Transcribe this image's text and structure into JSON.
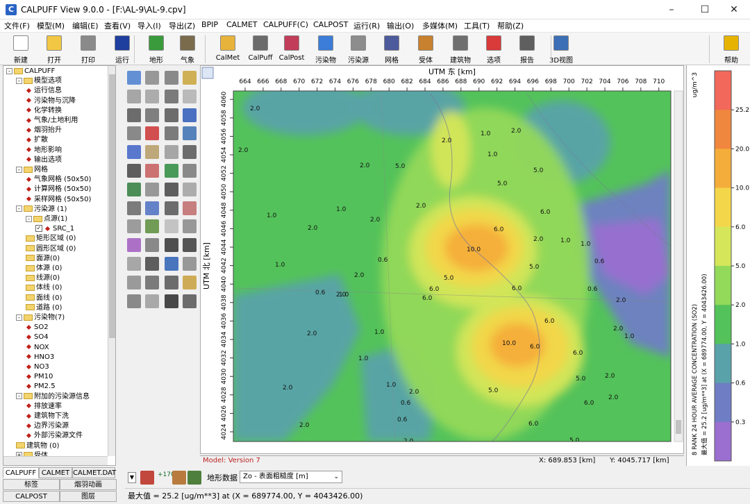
{
  "window": {
    "title": "CALPUFF View 9.0.0 - [F:\\AL-9\\AL-9.cpv]",
    "controls": [
      "–",
      "☐",
      "✕"
    ]
  },
  "menu": [
    "文件(F)",
    "模型(M)",
    "编辑(E)",
    "查看(V)",
    "导入(I)",
    "导出(Z)",
    "BPIP",
    "CALMET",
    "CALPUFF(C)",
    "CALPOST",
    "运行(R)",
    "输出(O)",
    "多媒体(M)",
    "工具(T)",
    "帮助(Z)"
  ],
  "toolbar": [
    {
      "label": "新建",
      "color": "#ffffff",
      "icon": "new-file-icon"
    },
    {
      "label": "打开",
      "color": "#f2c744",
      "icon": "open-folder-icon"
    },
    {
      "label": "打印",
      "color": "#8a8a8a",
      "icon": "printer-icon"
    },
    {
      "label": "运行",
      "color": "#1f3f9e",
      "icon": "run-triangle-icon"
    },
    {
      "label": "地形",
      "color": "#3a9b3c",
      "icon": "terrain-icon"
    },
    {
      "label": "气象",
      "color": "#7b6b4d",
      "icon": "meteorology-icon"
    },
    {
      "label": "CalMet",
      "color": "#e8b33a",
      "icon": "calmet-icon"
    },
    {
      "label": "CalPuff",
      "color": "#6b6b6b",
      "icon": "calpuff-icon"
    },
    {
      "label": "CalPost",
      "color": "#c23d5a",
      "icon": "calpost-icon"
    },
    {
      "label": "污染物",
      "color": "#3b7dd8",
      "icon": "pollutant-icon"
    },
    {
      "label": "污染源",
      "color": "#8d8d8d",
      "icon": "source-icon"
    },
    {
      "label": "网格",
      "color": "#4d5a9c",
      "icon": "grid-icon"
    },
    {
      "label": "受体",
      "color": "#c8812f",
      "icon": "receptor-icon"
    },
    {
      "label": "建筑物",
      "color": "#6f6f6f",
      "icon": "building-icon"
    },
    {
      "label": "选项",
      "color": "#d93a3a",
      "icon": "options-icon"
    },
    {
      "label": "报告",
      "color": "#5f5f5f",
      "icon": "report-icon"
    },
    {
      "label": "3D视图",
      "color": "#3d6fb6",
      "icon": "3d-view-icon"
    },
    {
      "label": "帮助",
      "color": "#e6b400",
      "icon": "help-icon"
    }
  ],
  "tree": [
    {
      "label": "CALPUFF",
      "level": 0,
      "type": "folder",
      "exp": "-"
    },
    {
      "label": "模型选项",
      "level": 1,
      "type": "folder",
      "exp": "-"
    },
    {
      "label": "运行信息",
      "level": 2,
      "type": "item"
    },
    {
      "label": "污染物与沉降",
      "level": 2,
      "type": "item"
    },
    {
      "label": "化学转换",
      "level": 2,
      "type": "item"
    },
    {
      "label": "气象/土地利用",
      "level": 2,
      "type": "item"
    },
    {
      "label": "烟羽抬升",
      "level": 2,
      "type": "item"
    },
    {
      "label": "扩散",
      "level": 2,
      "type": "item"
    },
    {
      "label": "地形影响",
      "level": 2,
      "type": "item"
    },
    {
      "label": "输出选项",
      "level": 2,
      "type": "item"
    },
    {
      "label": "网格",
      "level": 1,
      "type": "folder",
      "exp": "-"
    },
    {
      "label": "气象网格 (50x50)",
      "level": 2,
      "type": "item"
    },
    {
      "label": "计算网格 (50x50)",
      "level": 2,
      "type": "item"
    },
    {
      "label": "采样网格 (50x50)",
      "level": 2,
      "type": "item"
    },
    {
      "label": "污染源 (1)",
      "level": 1,
      "type": "folder",
      "exp": "-"
    },
    {
      "label": "点源(1)",
      "level": 2,
      "type": "folder",
      "exp": "-"
    },
    {
      "label": "SRC_1",
      "level": 3,
      "type": "check"
    },
    {
      "label": "矩形区域 (0)",
      "level": 2,
      "type": "folder"
    },
    {
      "label": "圆形区域 (0)",
      "level": 2,
      "type": "folder"
    },
    {
      "label": "面源(0)",
      "level": 2,
      "type": "folder"
    },
    {
      "label": "体源 (0)",
      "level": 2,
      "type": "folder"
    },
    {
      "label": "线源(0)",
      "level": 2,
      "type": "folder"
    },
    {
      "label": "体线 (0)",
      "level": 2,
      "type": "folder"
    },
    {
      "label": "面线 (0)",
      "level": 2,
      "type": "folder"
    },
    {
      "label": "道路 (0)",
      "level": 2,
      "type": "folder"
    },
    {
      "label": "污染物(7)",
      "level": 1,
      "type": "folder",
      "exp": "-"
    },
    {
      "label": "SO2",
      "level": 2,
      "type": "item"
    },
    {
      "label": "SO4",
      "level": 2,
      "type": "item"
    },
    {
      "label": "NOX",
      "level": 2,
      "type": "item"
    },
    {
      "label": "HNO3",
      "level": 2,
      "type": "item"
    },
    {
      "label": "NO3",
      "level": 2,
      "type": "item"
    },
    {
      "label": "PM10",
      "level": 2,
      "type": "item"
    },
    {
      "label": "PM2.5",
      "level": 2,
      "type": "item"
    },
    {
      "label": "附加的污染源信息",
      "level": 1,
      "type": "folder",
      "exp": "-"
    },
    {
      "label": "排放速率",
      "level": 2,
      "type": "item"
    },
    {
      "label": "建筑物下洗",
      "level": 2,
      "type": "item"
    },
    {
      "label": "边界污染源",
      "level": 2,
      "type": "item"
    },
    {
      "label": "外部污染源文件",
      "level": 2,
      "type": "item"
    },
    {
      "label": "建筑物 (0)",
      "level": 1,
      "type": "folder"
    },
    {
      "label": "受体",
      "level": 1,
      "type": "folder",
      "exp": "+"
    }
  ],
  "tabs_row1": [
    "CALPUFF",
    "CALMET",
    "CALMET.DAT"
  ],
  "tabs_row2": [
    "标签",
    "烟羽动画"
  ],
  "tabs_row3": [
    "CALPOST",
    "图层"
  ],
  "map": {
    "xlabel": "UTM 东 [km]",
    "ylabel": "UTM 北 [km]",
    "xticks": [
      "664",
      "666",
      "668",
      "670",
      "672",
      "674",
      "676",
      "678",
      "680",
      "682",
      "684",
      "686",
      "688",
      "690",
      "692",
      "694",
      "696",
      "698",
      "700",
      "702",
      "704",
      "706",
      "708",
      "710"
    ],
    "yticks": [
      "4024",
      "4026",
      "4028",
      "4030",
      "4032",
      "4034",
      "4036",
      "4038",
      "4040",
      "4042",
      "4044",
      "4046",
      "4048",
      "4050",
      "4052",
      "4054",
      "4056",
      "4058",
      "4060"
    ],
    "contours": [
      {
        "v": "2.0",
        "x": 7,
        "y": 88
      },
      {
        "v": "2.0",
        "x": 24,
        "y": 28
      },
      {
        "v": "1.0",
        "x": 48,
        "y": 182
      },
      {
        "v": "2.0",
        "x": 107,
        "y": 200
      },
      {
        "v": "2.0",
        "x": 182,
        "y": 110
      },
      {
        "v": "1.0",
        "x": 148,
        "y": 173
      },
      {
        "v": "1.0",
        "x": 60,
        "y": 253
      },
      {
        "v": "0.6",
        "x": 118,
        "y": 293
      },
      {
        "v": "2.0",
        "x": 106,
        "y": 352
      },
      {
        "v": "2.0",
        "x": 71,
        "y": 430
      },
      {
        "v": "2.0",
        "x": 95,
        "y": 484
      },
      {
        "v": "1.0",
        "x": 180,
        "y": 388
      },
      {
        "v": "1.0",
        "x": 220,
        "y": 426
      },
      {
        "v": "2.0",
        "x": 148,
        "y": 296
      },
      {
        "v": "6.0",
        "x": 272,
        "y": 301
      },
      {
        "v": "2.0",
        "x": 197,
        "y": 188
      },
      {
        "v": "2.0",
        "x": 263,
        "y": 168
      },
      {
        "v": "0.6",
        "x": 208,
        "y": 246
      },
      {
        "v": "2.0",
        "x": 174,
        "y": 268
      },
      {
        "v": "1.0",
        "x": 203,
        "y": 350
      },
      {
        "v": "1.0",
        "x": 152,
        "y": 296
      },
      {
        "v": "0.6",
        "x": 241,
        "y": 452
      },
      {
        "v": "5.0",
        "x": 233,
        "y": 111
      },
      {
        "v": "2.0",
        "x": 300,
        "y": 74
      },
      {
        "v": "5.0",
        "x": 380,
        "y": 136
      },
      {
        "v": "6.0",
        "x": 375,
        "y": 202
      },
      {
        "v": "10.0",
        "x": 336,
        "y": 231
      },
      {
        "v": "5.0",
        "x": 303,
        "y": 272
      },
      {
        "v": "6.0",
        "x": 282,
        "y": 288
      },
      {
        "v": "6.0",
        "x": 401,
        "y": 287
      },
      {
        "v": "5.0",
        "x": 426,
        "y": 256
      },
      {
        "v": "2.0",
        "x": 432,
        "y": 216
      },
      {
        "v": "1.0",
        "x": 366,
        "y": 94
      },
      {
        "v": "2.0",
        "x": 400,
        "y": 60
      },
      {
        "v": "5.0",
        "x": 432,
        "y": 117
      },
      {
        "v": "6.0",
        "x": 442,
        "y": 177
      },
      {
        "v": "1.0",
        "x": 471,
        "y": 218
      },
      {
        "v": "0.6",
        "x": 520,
        "y": 248
      },
      {
        "v": "0.6",
        "x": 510,
        "y": 288
      },
      {
        "v": "1.0",
        "x": 500,
        "y": 223
      },
      {
        "v": "2.0",
        "x": 547,
        "y": 345
      },
      {
        "v": "1.0",
        "x": 563,
        "y": 356
      },
      {
        "v": "2.0",
        "x": 551,
        "y": 304
      },
      {
        "v": "6.0",
        "x": 448,
        "y": 334
      },
      {
        "v": "6.0",
        "x": 489,
        "y": 380
      },
      {
        "v": "10.0",
        "x": 387,
        "y": 366
      },
      {
        "v": "6.0",
        "x": 427,
        "y": 371
      },
      {
        "v": "5.0",
        "x": 367,
        "y": 434
      },
      {
        "v": "6.0",
        "x": 425,
        "y": 482
      },
      {
        "v": "5.0",
        "x": 493,
        "y": 417
      },
      {
        "v": "6.0",
        "x": 505,
        "y": 452
      },
      {
        "v": "2.0",
        "x": 509,
        "y": 526
      },
      {
        "v": "2.0",
        "x": 420,
        "y": 556
      },
      {
        "v": "1.0",
        "x": 356,
        "y": 64
      },
      {
        "v": "5.0",
        "x": 484,
        "y": 506
      },
      {
        "v": "2.0",
        "x": 535,
        "y": 413
      },
      {
        "v": "2.0",
        "x": 540,
        "y": 444
      },
      {
        "v": "2.0",
        "x": 253,
        "y": 436
      },
      {
        "v": "2.0",
        "x": 245,
        "y": 507
      },
      {
        "v": "0.6",
        "x": 236,
        "y": 476
      }
    ]
  },
  "legend": {
    "unit": "ug/m^3",
    "ticks": [
      "25.2",
      "20.0",
      "10.0",
      "6.0",
      "5.0",
      "2.0",
      "1.0",
      "0.6",
      "0.3"
    ],
    "colors": [
      "#f2685b",
      "#f0873f",
      "#f4ad3a",
      "#f3d64a",
      "#d5e65a",
      "#93d95a",
      "#53c25a",
      "#5aa2a9",
      "#6f7ec4",
      "#9a6fd0"
    ],
    "caption": "8 RANK 24 HOUR AVERAGE CONCENTRATION (SO2)",
    "max_text": "最大值 = 25.2 [ug/m**3] at (X = 689774.00,  Y = 4043426.00)"
  },
  "status": {
    "model": "Model: Version 7",
    "x": "X: 689.853 [km]",
    "y": "Y: 4045.717 [km]"
  },
  "bottom": {
    "terrain_label": "地形数据",
    "terrain_value": "Zo - 表面粗糙度 [m]"
  },
  "footer": "最大值 = 25.2 [ug/m**3] at (X = 689774.00,  Y = 4043426.00)"
}
